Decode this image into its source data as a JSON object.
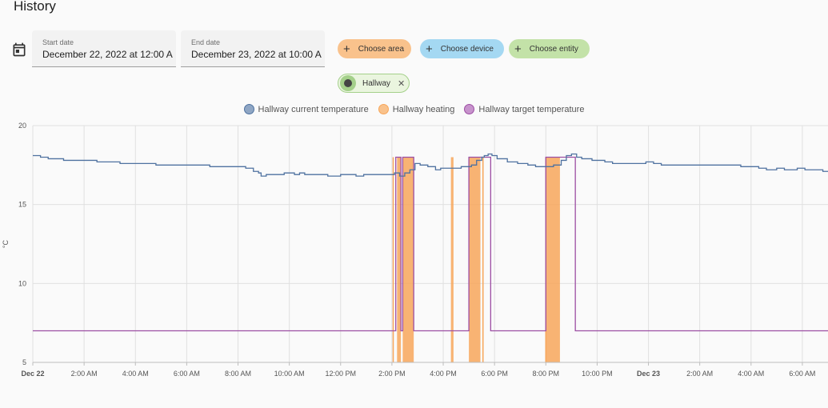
{
  "page": {
    "title": "History"
  },
  "date_picker": {
    "start": {
      "label": "Start date",
      "value": "December 22, 2022 at 12:00 A"
    },
    "end": {
      "label": "End date",
      "value": "December 23, 2022 at 10:00 A"
    }
  },
  "target_chips": {
    "area": {
      "label": "Choose area",
      "color": "#f9c28c"
    },
    "device": {
      "label": "Choose device",
      "color": "#a4d8f2"
    },
    "entity": {
      "label": "Choose entity",
      "color": "#c3e2a8"
    },
    "selected": {
      "label": "Hallway",
      "icon": "area-icon"
    }
  },
  "chart_data": {
    "type": "line",
    "ylabel": "°C",
    "ylim": [
      5,
      20
    ],
    "yticks": [
      5,
      10,
      15,
      20
    ],
    "xlim": [
      0,
      31
    ],
    "x_unit": "hours since Dec 22 00:00",
    "x_ticks": [
      {
        "x": 0,
        "label": "Dec 22",
        "bold": true
      },
      {
        "x": 2,
        "label": "2:00 AM"
      },
      {
        "x": 4,
        "label": "4:00 AM"
      },
      {
        "x": 6,
        "label": "6:00 AM"
      },
      {
        "x": 8,
        "label": "8:00 AM"
      },
      {
        "x": 10,
        "label": "10:00 AM"
      },
      {
        "x": 12,
        "label": "12:00 PM"
      },
      {
        "x": 14,
        "label": "2:00 PM"
      },
      {
        "x": 16,
        "label": "4:00 PM"
      },
      {
        "x": 18,
        "label": "6:00 PM"
      },
      {
        "x": 20,
        "label": "8:00 PM"
      },
      {
        "x": 22,
        "label": "10:00 PM"
      },
      {
        "x": 24,
        "label": "Dec 23",
        "bold": true
      },
      {
        "x": 26,
        "label": "2:00 AM"
      },
      {
        "x": 28,
        "label": "4:00 AM"
      },
      {
        "x": 30,
        "label": "6:00 AM"
      }
    ],
    "grid": true,
    "legend": "top-center",
    "series": [
      {
        "name": "Hallway current temperature",
        "color": "#4f72a0",
        "step": true,
        "points": [
          [
            0,
            18.1
          ],
          [
            0.3,
            18.0
          ],
          [
            0.6,
            17.9
          ],
          [
            1.2,
            17.8
          ],
          [
            1.8,
            17.8
          ],
          [
            2.5,
            17.7
          ],
          [
            3.4,
            17.6
          ],
          [
            4.5,
            17.6
          ],
          [
            4.8,
            17.5
          ],
          [
            6.5,
            17.5
          ],
          [
            6.9,
            17.4
          ],
          [
            8.3,
            17.3
          ],
          [
            8.6,
            17.1
          ],
          [
            8.8,
            17.0
          ],
          [
            8.9,
            16.8
          ],
          [
            9.1,
            16.9
          ],
          [
            9.8,
            17.0
          ],
          [
            10.0,
            17.0
          ],
          [
            10.2,
            16.9
          ],
          [
            10.4,
            17.0
          ],
          [
            10.6,
            16.9
          ],
          [
            11.5,
            16.8
          ],
          [
            12.0,
            16.9
          ],
          [
            12.6,
            16.8
          ],
          [
            12.9,
            16.9
          ],
          [
            13.5,
            16.9
          ],
          [
            14.0,
            16.9
          ],
          [
            14.1,
            17.0
          ],
          [
            14.3,
            16.8
          ],
          [
            14.5,
            17.0
          ],
          [
            14.7,
            17.2
          ],
          [
            14.9,
            17.6
          ],
          [
            15.1,
            17.5
          ],
          [
            15.4,
            17.4
          ],
          [
            15.7,
            17.2
          ],
          [
            15.9,
            17.3
          ],
          [
            16.7,
            17.4
          ],
          [
            17.1,
            17.5
          ],
          [
            17.3,
            17.8
          ],
          [
            17.5,
            18.0
          ],
          [
            17.6,
            18.1
          ],
          [
            17.75,
            18.2
          ],
          [
            17.9,
            18.1
          ],
          [
            18.1,
            17.9
          ],
          [
            18.5,
            17.7
          ],
          [
            18.9,
            17.6
          ],
          [
            19.3,
            17.5
          ],
          [
            19.6,
            17.4
          ],
          [
            20.3,
            17.5
          ],
          [
            20.6,
            17.8
          ],
          [
            20.8,
            18.1
          ],
          [
            21.0,
            18.2
          ],
          [
            21.2,
            18.0
          ],
          [
            21.4,
            17.9
          ],
          [
            21.8,
            17.8
          ],
          [
            22.3,
            17.7
          ],
          [
            22.6,
            17.6
          ],
          [
            23.1,
            17.6
          ],
          [
            23.9,
            17.7
          ],
          [
            24.2,
            17.6
          ],
          [
            24.5,
            17.5
          ],
          [
            27.4,
            17.5
          ],
          [
            27.6,
            17.4
          ],
          [
            28.3,
            17.3
          ],
          [
            28.6,
            17.2
          ],
          [
            29.0,
            17.3
          ],
          [
            29.3,
            17.2
          ],
          [
            29.8,
            17.3
          ],
          [
            30.1,
            17.2
          ],
          [
            30.7,
            17.2
          ],
          [
            30.8,
            17.1
          ],
          [
            31,
            17.1
          ]
        ]
      },
      {
        "name": "Hallway heating",
        "color": "#f7a65a",
        "fill_intervals": [
          [
            14.2,
            14.35
          ],
          [
            14.42,
            14.85
          ],
          [
            16.3,
            16.4
          ],
          [
            17.0,
            17.45
          ],
          [
            20.0,
            20.55
          ]
        ],
        "thin_intervals": [
          14.05,
          17.55,
          20.0
        ]
      },
      {
        "name": "Hallway target temperature",
        "color": "#9c4ea3",
        "step": true,
        "points": [
          [
            0,
            7
          ],
          [
            14.15,
            7
          ],
          [
            14.15,
            18
          ],
          [
            14.35,
            18
          ],
          [
            14.35,
            7
          ],
          [
            14.42,
            7
          ],
          [
            14.42,
            18
          ],
          [
            14.85,
            18
          ],
          [
            14.85,
            7
          ],
          [
            17.0,
            7
          ],
          [
            17.0,
            18
          ],
          [
            17.85,
            18
          ],
          [
            17.85,
            7
          ],
          [
            20.0,
            7
          ],
          [
            20.0,
            18
          ],
          [
            21.15,
            18
          ],
          [
            21.15,
            7
          ],
          [
            31,
            7
          ]
        ]
      }
    ]
  }
}
